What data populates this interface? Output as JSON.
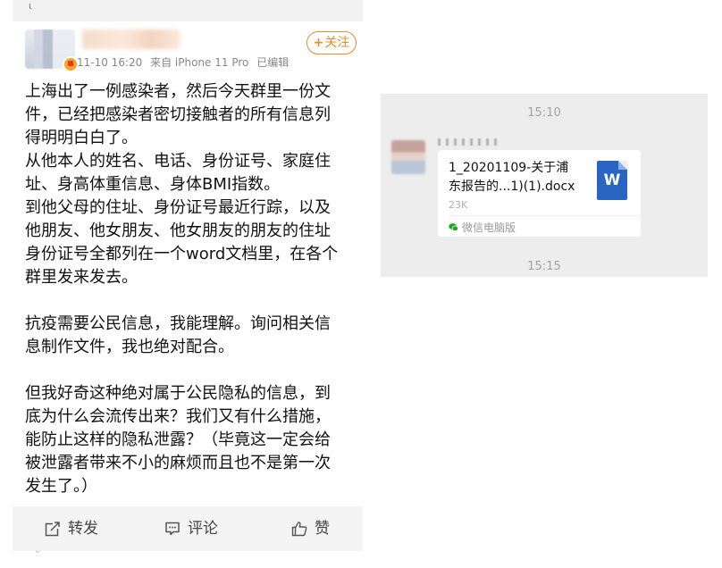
{
  "post": {
    "top_mark": "ι",
    "meta": {
      "date": "11-10 16:20",
      "source": "来自 iPhone 11 Pro",
      "edited": "已编辑"
    },
    "follow_label": "关注",
    "body_lines": [
      "上海出了一例感染者，然后今天群里一份文",
      "件，已经把感染者密切接触者的所有信息列",
      "得明明白白了。",
      "从他本人的姓名、电话、身份证号、家庭住",
      "址、身高体重信息、身体BMI指数。",
      "到他父母的住址、身份证号最近行踪，以及",
      "他朋友、他女朋友、他女朋友的朋友的住址",
      "身份证号全都列在一个word文档里，在各个",
      "群里发来发去。",
      "抗疫需要公民信息，我能理解。询问相关信",
      "息制作文件，我也绝对配合。",
      "但我好奇这种绝对属于公民隐私的信息，到",
      "底为什么会流传出来？我们又有什么措施，",
      "能防止这样的隐私泄露？（毕竟这一定会给",
      "被泄露者带来不小的麻烦而且也不是第一次",
      "发生了。）"
    ],
    "actions": {
      "share": "转发",
      "comment": "评论",
      "like": "赞"
    },
    "bottom_mark": "ᵕ"
  },
  "chat": {
    "time1": "15:10",
    "time2": "15:15",
    "file": {
      "name_line1": "1_20201109-关于浦",
      "name_line2": "东报告的...1)(1).docx",
      "size": "23K",
      "icon_letter": "W",
      "source": "微信电脑版"
    }
  },
  "colors": {
    "follow_orange": "#f08a24",
    "word_blue": "#2b65c4",
    "chat_bg": "#ededed",
    "wechat_green": "#1aad19"
  }
}
